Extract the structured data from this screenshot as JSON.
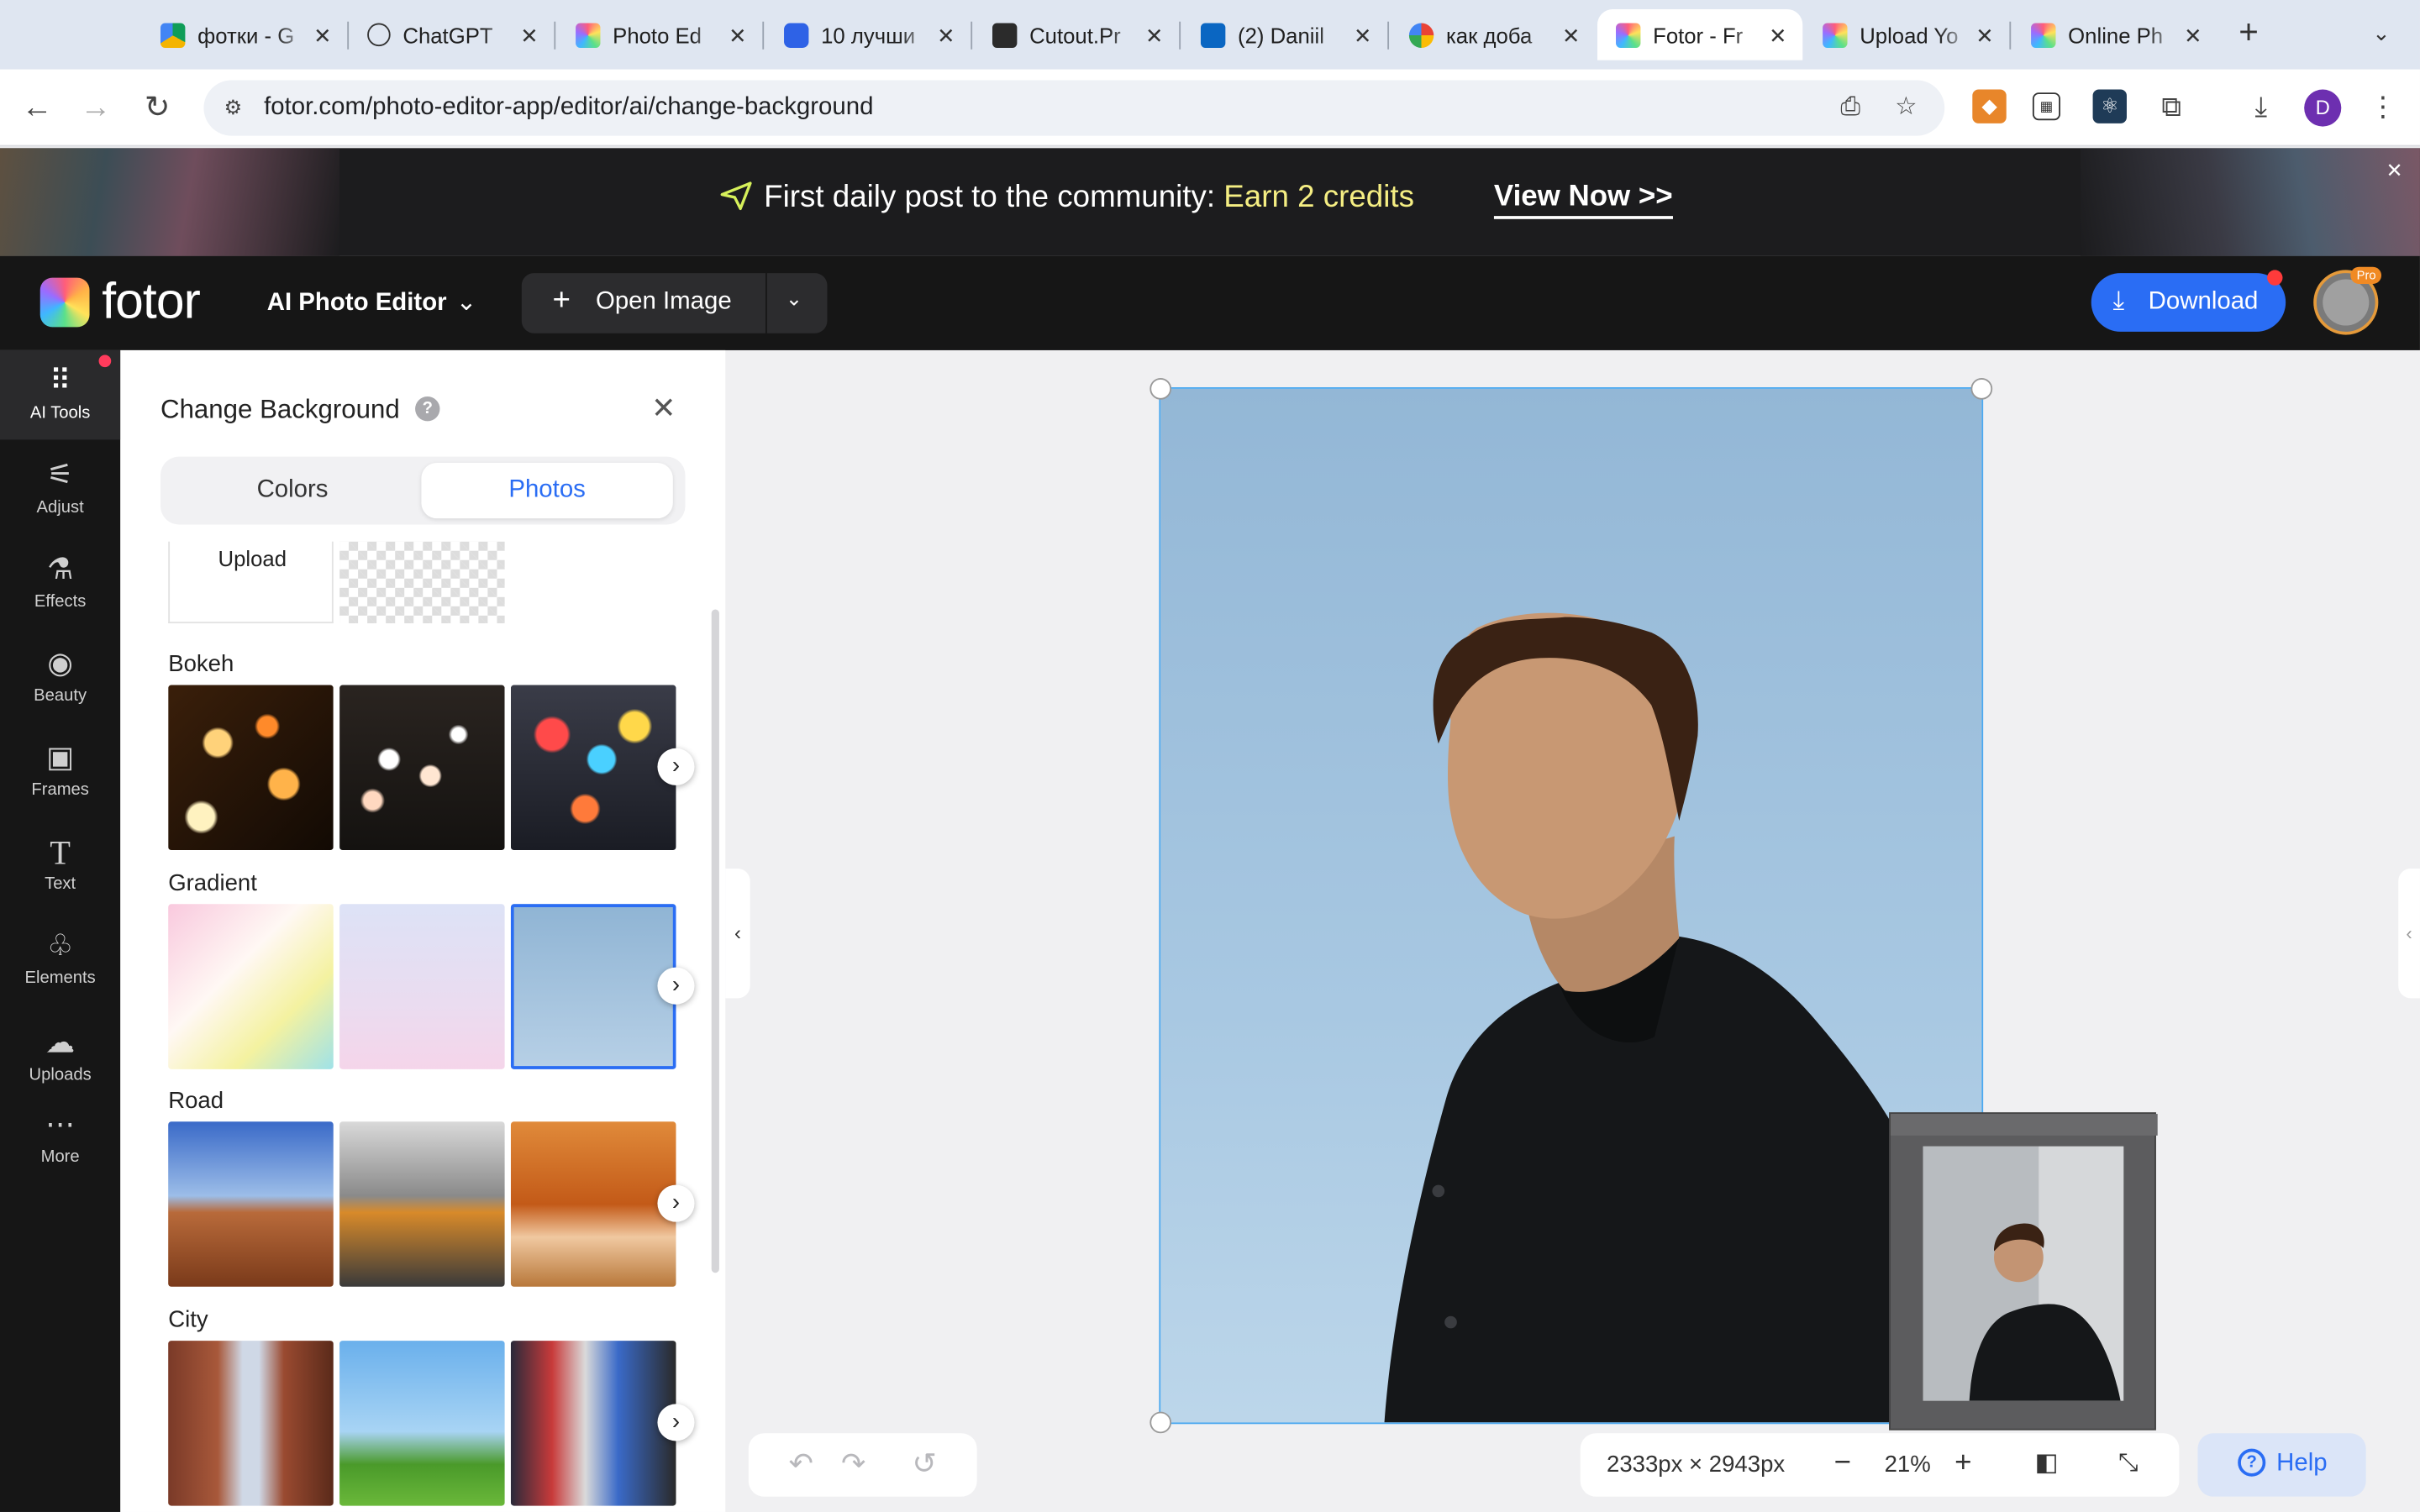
{
  "browser": {
    "tabs": [
      {
        "title": "фотки - G",
        "favicon": "google-drive-icon",
        "active": false
      },
      {
        "title": "ChatGPT",
        "favicon": "chatgpt-icon",
        "active": false
      },
      {
        "title": "Photo Ed",
        "favicon": "fotor-icon",
        "active": false
      },
      {
        "title": "10 лучши",
        "favicon": "blue-power-icon",
        "active": false
      },
      {
        "title": "Cutout.Pr",
        "favicon": "cutout-icon",
        "active": false
      },
      {
        "title": "(2) Daniil",
        "favicon": "linkedin-icon",
        "active": false
      },
      {
        "title": "как доба",
        "favicon": "google-icon",
        "active": false
      },
      {
        "title": "Fotor - Fr",
        "favicon": "fotor-icon",
        "active": true
      },
      {
        "title": "Upload Yo",
        "favicon": "fotor-icon",
        "active": false
      },
      {
        "title": "Online Ph",
        "favicon": "fotor-icon",
        "active": false
      }
    ],
    "url": "fotor.com/photo-editor-app/editor/ai/change-background",
    "profile_initial": "D"
  },
  "banner": {
    "text_prefix": "First daily post to the community: ",
    "text_highlight": "Earn 2 credits",
    "cta": "View Now >>",
    "close": "✕"
  },
  "header": {
    "logo": "fotor",
    "editor_menu": "AI Photo Editor",
    "open_image": "Open Image",
    "download": "Download",
    "pro_badge": "Pro"
  },
  "rail": [
    {
      "label": "AI Tools",
      "icon": "grid-dots-icon"
    },
    {
      "label": "Adjust",
      "icon": "sliders-icon"
    },
    {
      "label": "Effects",
      "icon": "flask-icon"
    },
    {
      "label": "Beauty",
      "icon": "eye-icon"
    },
    {
      "label": "Frames",
      "icon": "frame-icon"
    },
    {
      "label": "Text",
      "icon": "text-icon"
    },
    {
      "label": "Elements",
      "icon": "shapes-icon"
    },
    {
      "label": "Uploads",
      "icon": "cloud-upload-icon"
    },
    {
      "label": "More",
      "icon": "more-dots-icon"
    }
  ],
  "panel": {
    "title": "Change Background",
    "tabs": [
      "Colors",
      "Photos"
    ],
    "selected_tab": "Photos",
    "upload_label": "Upload",
    "categories": [
      {
        "name": "Bokeh"
      },
      {
        "name": "Gradient"
      },
      {
        "name": "Road"
      },
      {
        "name": "City"
      }
    ]
  },
  "canvas": {
    "dimensions": "2333px × 2943px",
    "zoom": "21%",
    "help": "Help"
  },
  "colors": {
    "accent": "#2a6df4",
    "dark_bg": "#161616",
    "banner_highlight": "#f5ee83"
  }
}
